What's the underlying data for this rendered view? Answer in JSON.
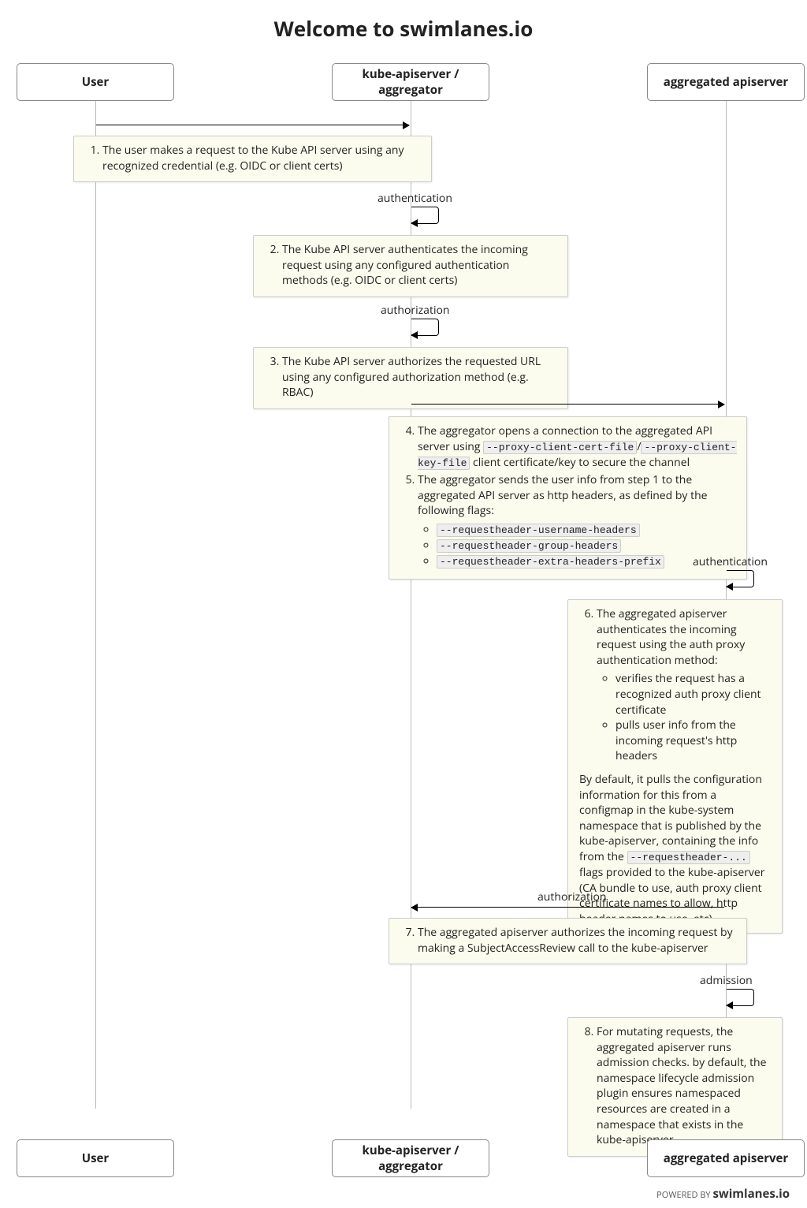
{
  "title": "Welcome to swimlanes.io",
  "actors": {
    "user": "User",
    "kube": "kube-apiserver / aggregator",
    "agg": "aggregated apiserver"
  },
  "labels": {
    "authn": "authentication",
    "authz": "authorization",
    "admission": "admission"
  },
  "notes": {
    "n1": "The user makes a request to the Kube API server using any recognized credential (e.g. OIDC or client certs)",
    "n2": "The Kube API server authenticates the incoming request using any configured authentication methods (e.g. OIDC or client certs)",
    "n3": "The Kube API server authorizes the requested URL using any configured authorization method (e.g. RBAC)",
    "n4_a": "The aggregator opens a connection to the aggregated API server using ",
    "n4_c1": "--proxy-client-cert-file",
    "n4_c2": "--proxy-client-key-file",
    "n4_b": " client certificate/key to secure the channel",
    "n5_a": "The aggregator sends the user info from step 1 to the aggregated API server as http headers, as defined by the following flags:",
    "n5_f1": "--requestheader-username-headers",
    "n5_f2": "--requestheader-group-headers",
    "n5_f3": "--requestheader-extra-headers-prefix",
    "n6_a": "The aggregated apiserver authenticates the incoming request using the auth proxy authentication method:",
    "n6_b1": "verifies the request has a recognized auth proxy client certificate",
    "n6_b2": "pulls user info from the incoming request's http headers",
    "n6_c1": "By default, it pulls the configuration information for this from a configmap in the kube-system namespace that is published by the kube-apiserver, containing the info from the ",
    "n6_code": "--requestheader-...",
    "n6_c2": " flags provided to the kube-apiserver (CA bundle to use, auth proxy client certificate names to allow, http header names to use, etc)",
    "n7": "The aggregated apiserver authorizes the incoming request by making a SubjectAccessReview call to the kube-apiserver",
    "n8": "For mutating requests, the aggregated apiserver runs admission checks. by default, the namespace lifecycle admission plugin ensures namespaced resources are created in a namespace that exists in the kube-apiserver"
  },
  "footer": {
    "pre": "POWERED BY ",
    "brand": "swimlanes.io"
  }
}
